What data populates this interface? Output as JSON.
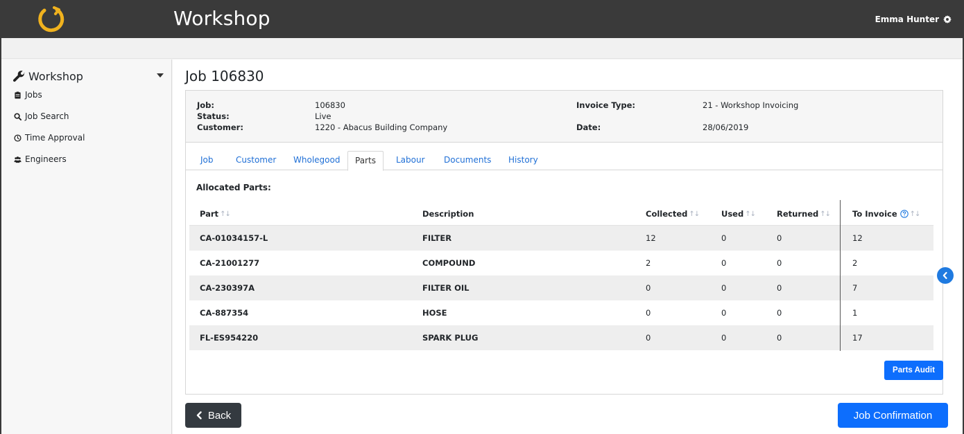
{
  "app": {
    "title": "Workshop",
    "user_name": "Emma Hunter",
    "brand_color": "#f0b21e",
    "accent": "#0d6efd"
  },
  "sidebar": {
    "section_label": "Workshop",
    "items": [
      {
        "label": "Jobs",
        "icon": "clipboard-icon"
      },
      {
        "label": "Job Search",
        "icon": "search-icon"
      },
      {
        "label": "Time Approval",
        "icon": "clock-icon"
      },
      {
        "label": "Engineers",
        "icon": "users-icon"
      }
    ]
  },
  "page": {
    "title": "Job 106830"
  },
  "job_info": {
    "job_label": "Job:",
    "job_value": "106830",
    "status_label": "Status:",
    "status_value": "Live",
    "customer_label": "Customer:",
    "customer_value": "1220 - Abacus Building Company",
    "invoice_type_label": "Invoice Type:",
    "invoice_type_value": "21 - Workshop Invoicing",
    "date_label": "Date:",
    "date_value": "28/06/2019"
  },
  "tabs": [
    {
      "label": "Job",
      "active": false
    },
    {
      "label": "Customer",
      "active": false
    },
    {
      "label": "Wholegood",
      "active": false
    },
    {
      "label": "Parts",
      "active": true
    },
    {
      "label": "Labour",
      "active": false
    },
    {
      "label": "Documents",
      "active": false
    },
    {
      "label": "History",
      "active": false
    }
  ],
  "parts": {
    "section_label": "Allocated Parts:",
    "columns": [
      "Part",
      "Description",
      "Collected",
      "Used",
      "Returned",
      "To Invoice"
    ],
    "rows": [
      {
        "part": "CA-01034157-L",
        "description": "FILTER",
        "collected": "12",
        "used": "0",
        "returned": "0",
        "to_invoice": "12"
      },
      {
        "part": "CA-21001277",
        "description": "COMPOUND",
        "collected": "2",
        "used": "0",
        "returned": "0",
        "to_invoice": "2"
      },
      {
        "part": "CA-230397A",
        "description": "FILTER OIL",
        "collected": "0",
        "used": "0",
        "returned": "0",
        "to_invoice": "7"
      },
      {
        "part": "CA-887354",
        "description": "HOSE",
        "collected": "0",
        "used": "0",
        "returned": "0",
        "to_invoice": "1"
      },
      {
        "part": "FL-ES954220",
        "description": "SPARK PLUG",
        "collected": "0",
        "used": "0",
        "returned": "0",
        "to_invoice": "17"
      }
    ],
    "audit_button": "Parts Audit"
  },
  "footer": {
    "back_label": "Back",
    "confirm_label": "Job Confirmation"
  }
}
